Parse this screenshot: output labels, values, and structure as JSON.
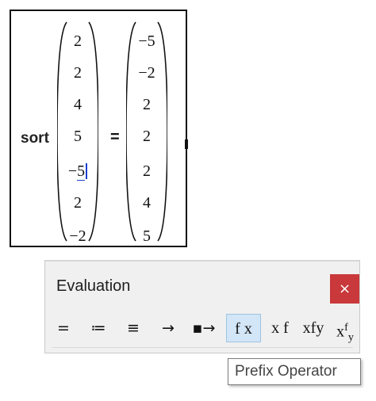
{
  "math": {
    "function_name": "sort",
    "equals": "=",
    "input_vector": [
      "2",
      "2",
      "4",
      "5",
      "−5",
      "2",
      "−2"
    ],
    "result_vector": [
      "−5",
      "−2",
      "2",
      "2",
      "2",
      "4",
      "5"
    ]
  },
  "eval_panel": {
    "title": "Evaluation",
    "close_label": "×",
    "buttons": [
      {
        "name": "evaluate",
        "label": "="
      },
      {
        "name": "definition",
        "label": "≔"
      },
      {
        "name": "global-definition",
        "label": "≡"
      },
      {
        "name": "symbolic-evaluation",
        "label": "→"
      },
      {
        "name": "symbolic-keyword",
        "label": "▪→"
      },
      {
        "name": "prefix-operator",
        "label": "f x"
      },
      {
        "name": "postfix-operator",
        "label": "x f"
      },
      {
        "name": "infix-operator",
        "label": "xfy"
      },
      {
        "name": "treefix-operator",
        "label_base": "x",
        "label_sup": "f",
        "label_sub": "y"
      }
    ],
    "selected_button": "prefix-operator"
  },
  "tooltip": {
    "text": "Prefix Operator"
  }
}
